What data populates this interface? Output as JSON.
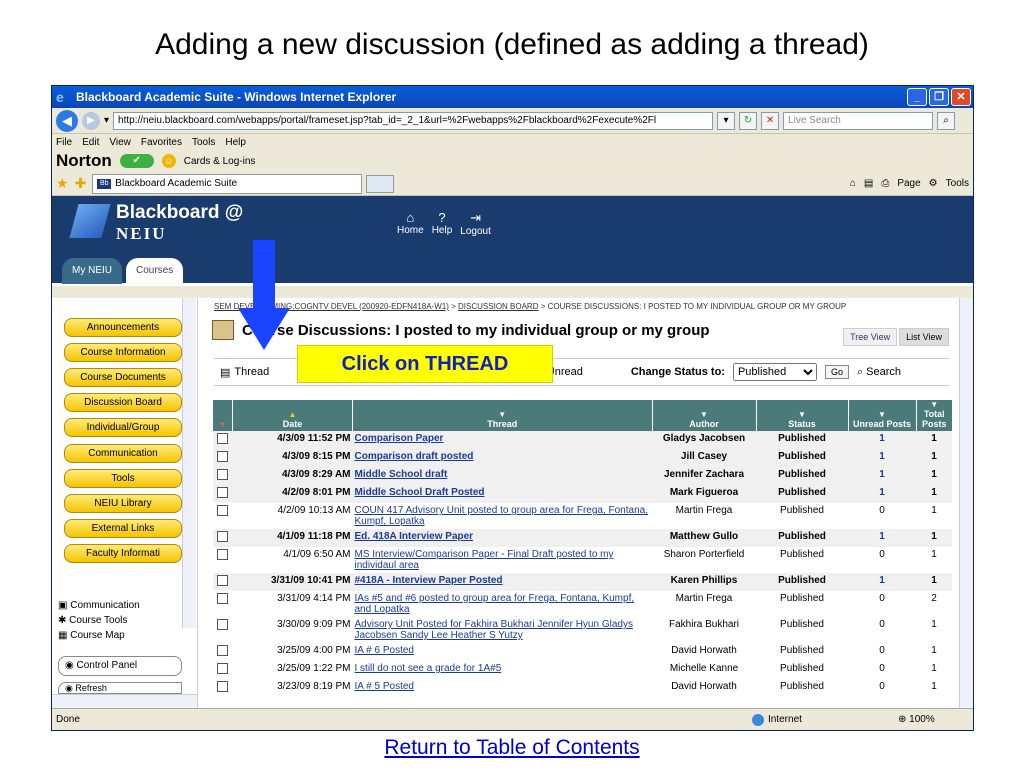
{
  "slide": {
    "title": "Adding a new discussion (defined as adding a thread)",
    "footer_link": "Return to Table of Contents",
    "callout": "Click on THREAD"
  },
  "browser": {
    "title": "Blackboard Academic Suite - Windows Internet Explorer",
    "url": "http://neiu.blackboard.com/webapps/portal/frameset.jsp?tab_id=_2_1&url=%2Fwebapps%2Fblackboard%2Fexecute%2Fl",
    "search_placeholder": "Live Search",
    "menu": [
      "File",
      "Edit",
      "View",
      "Favorites",
      "Tools",
      "Help"
    ],
    "norton_label": "Norton",
    "cards_label": "Cards & Log-ins",
    "tab_label": "Blackboard Academic Suite",
    "page_label": "Page",
    "tools_label": "Tools",
    "status_text": "Done",
    "zone_text": "Internet",
    "zoom_text": "100%"
  },
  "bb": {
    "logo_line1": "Blackboard @",
    "logo_line2": "NEIU",
    "header_links": [
      "Home",
      "Help",
      "Logout"
    ],
    "tabs": [
      "My NEIU",
      "Courses"
    ]
  },
  "leftnav": {
    "buttons": [
      "Announcements",
      "Course Information",
      "Course Documents",
      "Discussion Board",
      "Individual/Group",
      "Communication",
      "Tools",
      "NEIU Library",
      "External Links",
      "Faculty Informati"
    ],
    "tools": [
      "Communication",
      "Course Tools",
      "Course Map"
    ],
    "control_panel": "Control Panel",
    "refresh": "Refresh"
  },
  "main": {
    "breadcrumb_course": "SEM DEVELOPMING:COGNTV DEVEL (200920-EDFN418A-W1)",
    "breadcrumb_board": "DISCUSSION BOARD",
    "breadcrumb_rest": "> COURSE DISCUSSIONS: I POSTED TO MY INDIVIDUAL GROUP OR MY GROUP",
    "title": "Course Discussions: I posted to my individual group or my group",
    "tree_view": "Tree View",
    "list_view": "List View",
    "thread_btn": "Thread",
    "mark_unread": "Mark Unread",
    "change_status": "Change Status to:",
    "status_selected": "Published",
    "go": "Go",
    "search": "Search",
    "columns": [
      "Date",
      "Thread",
      "Author",
      "Status",
      "Unread Posts",
      "Total Posts"
    ],
    "rows": [
      {
        "date": "4/3/09 11:52 PM",
        "thread": "Comparison Paper",
        "author": "Gladys Jacobsen",
        "status": "Published",
        "unread": "1",
        "total": "1",
        "bold": true
      },
      {
        "date": "4/3/09 8:15 PM",
        "thread": "Comparison draft posted",
        "author": "Jill Casey",
        "status": "Published",
        "unread": "1",
        "total": "1",
        "bold": true
      },
      {
        "date": "4/3/09 8:29 AM",
        "thread": "Middle School draft",
        "author": "Jennifer Zachara",
        "status": "Published",
        "unread": "1",
        "total": "1",
        "bold": true
      },
      {
        "date": "4/2/09 8:01 PM",
        "thread": "Middle School Draft Posted",
        "author": "Mark Figueroa",
        "status": "Published",
        "unread": "1",
        "total": "1",
        "bold": true
      },
      {
        "date": "4/2/09 10:13 AM",
        "thread": "COUN 417 Advisory Unit posted to group area for Frega, Fontana, Kumpf, Lopatka",
        "author": "Martin Frega",
        "status": "Published",
        "unread": "0",
        "total": "1",
        "bold": false
      },
      {
        "date": "4/1/09 11:18 PM",
        "thread": "Ed. 418A Interview Paper",
        "author": "Matthew Gullo",
        "status": "Published",
        "unread": "1",
        "total": "1",
        "bold": true
      },
      {
        "date": "4/1/09 6:50 AM",
        "thread": "MS Interview/Comparison Paper - Final Draft posted to my individaul area",
        "author": "Sharon Porterfield",
        "status": "Published",
        "unread": "0",
        "total": "1",
        "bold": false
      },
      {
        "date": "3/31/09 10:41 PM",
        "thread": "#418A - Interview Paper Posted",
        "author": "Karen Phillips",
        "status": "Published",
        "unread": "1",
        "total": "1",
        "bold": true
      },
      {
        "date": "3/31/09 4:14 PM",
        "thread": "IAs #5 and #6 posted to group area for Frega, Fontana, Kumpf, and Lopatka",
        "author": "Martin Frega",
        "status": "Published",
        "unread": "0",
        "total": "2",
        "bold": false
      },
      {
        "date": "3/30/09 9:09 PM",
        "thread": "Advisory Unit Posted for Fakhira Bukhari Jennifer Hyun Gladys Jacobsen Sandy Lee Heather S Yutzy",
        "author": "Fakhira Bukhari",
        "status": "Published",
        "unread": "0",
        "total": "1",
        "bold": false
      },
      {
        "date": "3/25/09 4:00 PM",
        "thread": "IA # 6 Posted",
        "author": "David Horwath",
        "status": "Published",
        "unread": "0",
        "total": "1",
        "bold": false
      },
      {
        "date": "3/25/09 1:22 PM",
        "thread": "I still do not see a grade for 1A#5",
        "author": "Michelle Kanne",
        "status": "Published",
        "unread": "0",
        "total": "1",
        "bold": false
      },
      {
        "date": "3/23/09 8:19 PM",
        "thread": "IA # 5 Posted",
        "author": "David Horwath",
        "status": "Published",
        "unread": "0",
        "total": "1",
        "bold": false
      }
    ]
  }
}
